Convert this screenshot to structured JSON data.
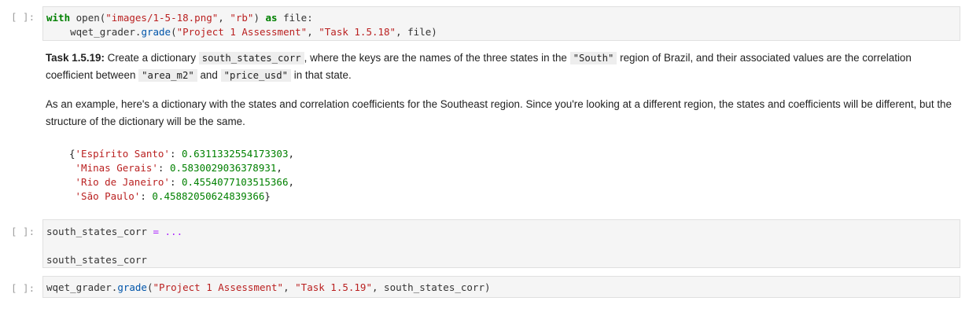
{
  "cell_prompt": "[ ]:",
  "cells": {
    "cell1": {
      "kw_with": "with",
      "fn_open": "open",
      "str_path": "\"images/1-5-18.png\"",
      "str_mode": "\"rb\"",
      "kw_as": "as",
      "var_file": "file:",
      "obj": "wqet_grader",
      "fn_grade": "grade",
      "str_assessment": "\"Project 1 Assessment\"",
      "str_task": "\"Task 1.5.18\"",
      "arg_file": "file"
    },
    "cell2": {
      "var": "south_states_corr",
      "op": "=",
      "ellipsis": "...",
      "line2": "south_states_corr"
    },
    "cell3": {
      "obj": "wqet_grader",
      "fn_grade": "grade",
      "str_assessment": "\"Project 1 Assessment\"",
      "str_task": "\"Task 1.5.19\"",
      "arg": "south_states_corr"
    }
  },
  "markdown": {
    "task_label": "Task 1.5.19:",
    "p1_a": " Create a dictionary ",
    "p1_code1": "south_states_corr",
    "p1_b": ", where the keys are the names of the three states in the ",
    "p1_code2": "\"South\"",
    "p1_c": " region of Brazil, and their associated values are the correlation coefficient between ",
    "p1_code3": "\"area_m2\"",
    "p1_d": " and ",
    "p1_code4": "\"price_usd\"",
    "p1_e": " in that state.",
    "p2": "As an example, here's a dictionary with the states and correlation coefficients for the Southeast region. Since you're looking at a different region, the states and coefficients will be different, but the structure of the dictionary will be the same.",
    "example": [
      {
        "key": "'Espírito Santo'",
        "value": "0.6311332554173303"
      },
      {
        "key": "'Minas Gerais'",
        "value": "0.5830029036378931"
      },
      {
        "key": "'Rio de Janeiro'",
        "value": "0.4554077103515366"
      },
      {
        "key": "'São Paulo'",
        "value": "0.45882050624839366"
      }
    ]
  }
}
